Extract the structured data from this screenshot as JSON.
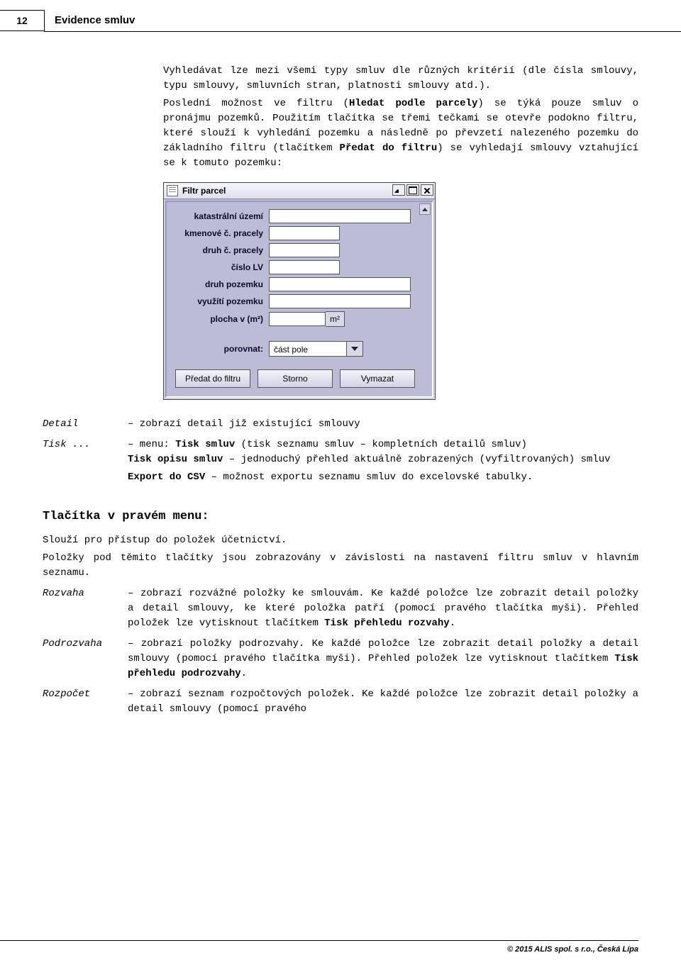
{
  "header": {
    "page_number": "12",
    "title": "Evidence smluv"
  },
  "intro": {
    "p1_a": "Vyhledávat lze mezi všemi typy smluv dle různých kritérií (dle čísla smlouvy, typu smlouvy, smluvních stran, platnosti smlouvy atd.).",
    "p2_a": "Poslední možnost ve filtru (",
    "p2_b": "Hledat podle parcely",
    "p2_c": ") se týká pouze smluv o pronájmu pozemků. Použitím tlačítka se třemi tečkami se otevře podokno filtru, které slouží k vyhledání pozemku a následně po převzetí nalezeného pozemku do základního filtru (tlačítkem ",
    "p2_d": "Předat do filtru",
    "p2_e": ") se vyhledají smlouvy vztahující se k tomuto pozemku:"
  },
  "filter_window": {
    "title": "Filtr parcel",
    "fields": {
      "katastr": "katastrální území",
      "kmen": "kmenové č. pracely",
      "druhc": "druh č. pracely",
      "cislolv": "číslo LV",
      "druhpoz": "druh pozemku",
      "vyuziti": "využítí pozemku",
      "plocha": "plocha v (m²)",
      "m2_suffix": "m²",
      "porovnat": "porovnat:",
      "porovnat_value": "část pole"
    },
    "buttons": {
      "predat": "Předat do filtru",
      "storno": "Storno",
      "vymazat": "Vymazat"
    }
  },
  "defs1": {
    "detail_t": "Detail",
    "detail_d": "– zobrazí detail již existující smlouvy",
    "tisk_t": "Tisk ...",
    "tisk_d_a": "– menu: ",
    "tisk_d_b": "Tisk smluv",
    "tisk_d_c": " (tisk seznamu smluv – kompletních detailů smluv)",
    "tisk_sub1_a": "Tisk opisu smluv",
    "tisk_sub1_b": " – jednoduchý přehled aktuálně zobrazených (vyfiltrovaných) smluv",
    "tisk_sub2_a": "Export do CSV",
    "tisk_sub2_b": " – možnost exportu seznamu smluv do excelovské tabulky."
  },
  "section2_title": "Tlačítka v pravém menu:",
  "section2": {
    "p1": "Slouží pro přístup do položek účetnictví.",
    "p2": "Položky pod těmito tlačítky jsou zobrazovány v závislosti na nastavení filtru smluv v hlavním seznamu."
  },
  "defs2": {
    "rozvaha_t": "Rozvaha",
    "rozvaha_a": "– zobrazí rozvážné položky ke smlouvám. Ke každé položce lze zobrazit detail položky a detail smlouvy, ke které položka patří (pomocí pravého tlačítka myši). Přehled položek lze vytisknout tlačítkem ",
    "rozvaha_b": "Tisk přehledu rozvahy",
    "rozvaha_c": ".",
    "podrozvaha_t": "Podrozvaha",
    "podrozvaha_a": "– zobrazí položky podrozvahy. Ke každé položce lze zobrazit detail položky a detail smlouvy (pomocí pravého tlačítka myši). Přehled položek lze vytisknout tlačítkem ",
    "podrozvaha_b": "Tisk přehledu podrozvahy",
    "podrozvaha_c": ".",
    "rozpocet_t": "Rozpočet",
    "rozpocet_a": "– zobrazí seznam rozpočtových položek. Ke každé položce lze zobrazit detail položky a detail smlouvy (pomocí pravého"
  },
  "footer": "© 2015 ALIS spol. s r.o., Česká Lípa"
}
